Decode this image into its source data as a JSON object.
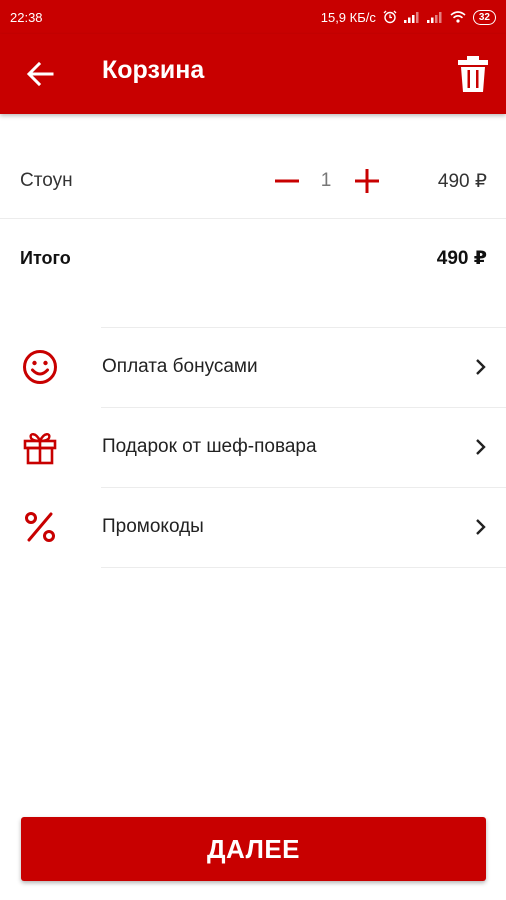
{
  "status_bar": {
    "time": "22:38",
    "network_speed": "15,9 КБ/с",
    "battery": "32",
    "icons": [
      "alarm-icon",
      "signal-icon",
      "signal-icon",
      "wifi-icon",
      "battery-icon"
    ]
  },
  "app_bar": {
    "title": "Корзина",
    "back_icon": "arrow-left-icon",
    "delete_icon": "trash-icon"
  },
  "cart": {
    "items": [
      {
        "name": "Стоун",
        "quantity": "1",
        "price": "490 ₽"
      }
    ],
    "total_label": "Итого",
    "total_value": "490 ₽"
  },
  "menu": {
    "items": [
      {
        "label": "Оплата бонусами",
        "icon": "smiley-icon"
      },
      {
        "label": "Подарок от шеф-повара",
        "icon": "gift-icon"
      },
      {
        "label": "Промокоды",
        "icon": "percent-icon"
      }
    ]
  },
  "footer": {
    "next_label": "ДАЛЕЕ"
  },
  "colors": {
    "primary": "#c80000",
    "text": "#222222",
    "divider": "#ececec"
  }
}
